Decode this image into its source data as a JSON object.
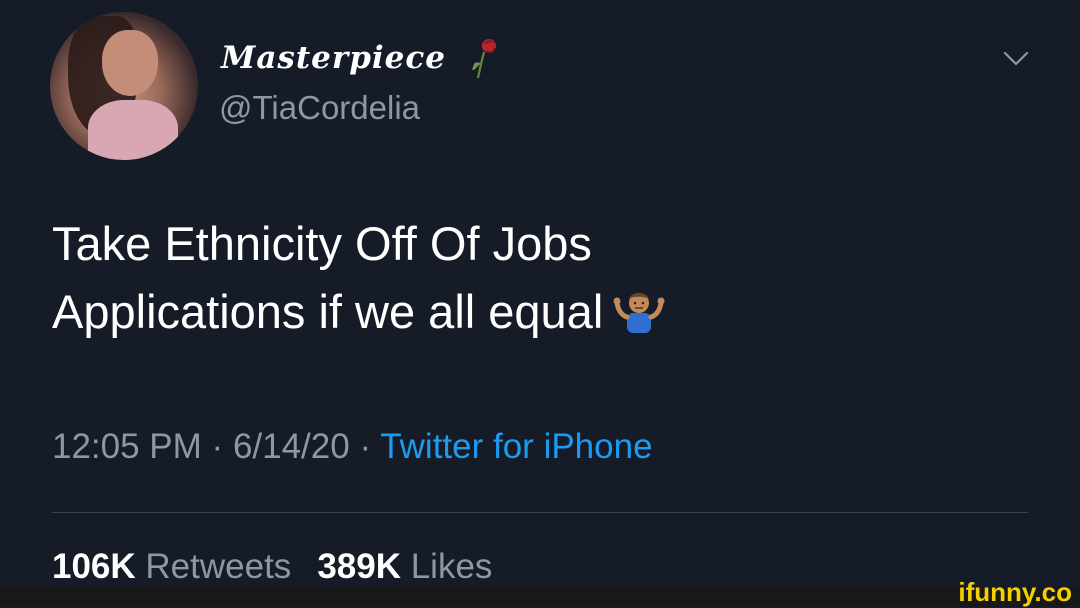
{
  "tweet": {
    "display_name": "Masterpiece",
    "handle": "@TiaCordelia",
    "text_line1": "Take Ethnicity Off Of Jobs",
    "text_line2": "Applications if we all equal",
    "time": "12:05 PM",
    "date": "6/14/20",
    "separator": "·",
    "source": "Twitter for iPhone",
    "retweets_count": "106K",
    "retweets_label": "Retweets",
    "likes_count": "389K",
    "likes_label": "Likes"
  },
  "icons": {
    "name_emoji": "wilted-rose-icon",
    "text_emoji": "person-shrugging-icon",
    "menu": "chevron-down-icon"
  },
  "watermark": {
    "text": "ifunny.co"
  },
  "colors": {
    "background": "#151c27",
    "primary_text": "#ffffff",
    "secondary_text": "#8b98a5",
    "link": "#1d9bf0",
    "watermark": "#f4d000"
  }
}
